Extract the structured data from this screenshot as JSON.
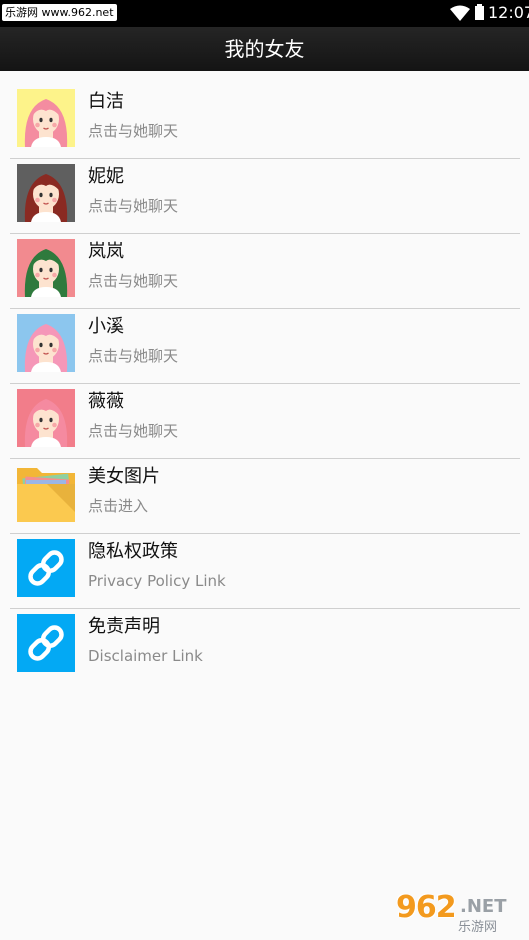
{
  "status_bar": {
    "watermark_text": "乐游网 www.962.net",
    "time": "12:07"
  },
  "app_bar": {
    "title": "我的女友"
  },
  "list": [
    {
      "title": "白洁",
      "subtitle": "点击与她聊天",
      "thumb": "girl-avatar-icon",
      "bg": "#fdf38a",
      "hair": "#f48ca0"
    },
    {
      "title": "妮妮",
      "subtitle": "点击与她聊天",
      "thumb": "girl-avatar-icon",
      "bg": "#5f5f5f",
      "hair": "#8a2a22"
    },
    {
      "title": "岚岚",
      "subtitle": "点击与她聊天",
      "thumb": "girl-avatar-icon",
      "bg": "#f28a8f",
      "hair": "#2f7a3d"
    },
    {
      "title": "小溪",
      "subtitle": "点击与她聊天",
      "thumb": "girl-avatar-icon",
      "bg": "#8cc6ee",
      "hair": "#f597b8"
    },
    {
      "title": "薇薇",
      "subtitle": "点击与她聊天",
      "thumb": "girl-avatar-icon",
      "bg": "#f27d8a",
      "hair": "#f58aa0"
    },
    {
      "title": "美女图片",
      "subtitle": "点击进入",
      "thumb": "folder-icon"
    },
    {
      "title": "隐私权政策",
      "subtitle": "Privacy Policy Link",
      "thumb": "link-icon"
    },
    {
      "title": "免责声明",
      "subtitle": "Disclaimer Link",
      "thumb": "link-icon"
    }
  ],
  "watermark_logo": {
    "main": "962",
    "net": ".NET",
    "sub": "乐游网"
  },
  "colors": {
    "link_tile": "#03a9f4",
    "folder": "#fbc94f"
  }
}
